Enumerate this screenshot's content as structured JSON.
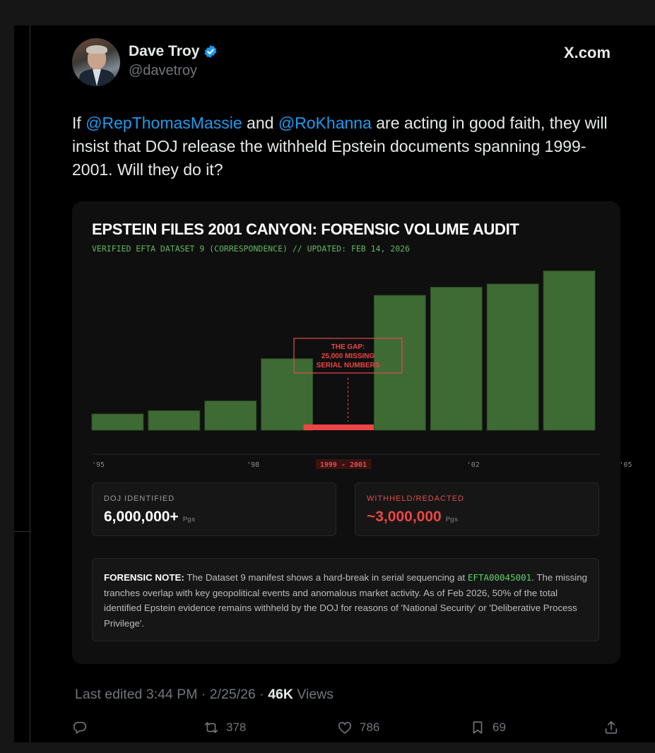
{
  "author": {
    "display_name": "Dave Troy",
    "handle": "@davetroy",
    "verified_icon": "verified-badge-icon"
  },
  "source_site": "X.com",
  "tweet": {
    "prefix": "If ",
    "mention_1": "@RepThomasMassie",
    "mid": " and ",
    "mention_2": "@RoKhanna",
    "rest": " are acting in good faith, they will insist that DOJ release the withheld Epstein documents spanning 1999-2001. Will they do it?"
  },
  "card": {
    "title": "EPSTEIN FILES 2001 CANYON: FORENSIC VOLUME AUDIT",
    "subtitle": "VERIFIED EFTA DATASET 9 (CORRESPONDENCE) // UPDATED: FEB 14, 2026",
    "stats": [
      {
        "label": "DOJ IDENTIFIED",
        "value": "6,000,000+",
        "unit": "Pgs"
      },
      {
        "label": "WITHHELD/REDACTED",
        "value": "~3,000,000",
        "unit": "Pgs"
      }
    ],
    "note": {
      "lead": "FORENSIC NOTE:",
      "text_1": " The Dataset 9 manifest shows a hard-break in serial sequencing at ",
      "code": "EFTA00045001",
      "text_2": ". The missing tranches overlap with key geopolitical events and anomalous market activity. As of Feb 2026, 50% of the total identified Epstein evidence remains withheld by the DOJ for reasons of 'National Security' or 'Deliberative Process Privilege'."
    }
  },
  "chart_data": {
    "type": "bar",
    "title": "",
    "xlabel": "",
    "ylabel": "",
    "grid": false,
    "bar_color": "#3e6b34",
    "gap_color": "#ef4444",
    "values": [
      1.0,
      1.2,
      1.8,
      4.4,
      0.35,
      8.3,
      8.8,
      9.0,
      9.8
    ],
    "gap_index": 4,
    "ylim": [
      0,
      10
    ],
    "tick_labels": [
      {
        "label": "'95",
        "at": 0
      },
      {
        "label": "'98",
        "at": 2.4
      },
      {
        "label": "1999 - 2001",
        "at": 4,
        "highlight": true
      },
      {
        "label": "'02",
        "at": 6.3
      },
      {
        "label": "'05",
        "at": 9
      }
    ],
    "annotation": [
      "THE GAP:",
      "25,000 MISSING",
      "SERIAL NUMBERS"
    ]
  },
  "meta": {
    "edited": "Last edited 3:44 PM · 2/25/26",
    "sep": " · ",
    "views_count": "46K",
    "views_label": " Views"
  },
  "actions": {
    "reply_icon": "reply-icon",
    "retweets": "378",
    "likes": "786",
    "bookmarks": "69",
    "share_icon": "share-icon"
  }
}
